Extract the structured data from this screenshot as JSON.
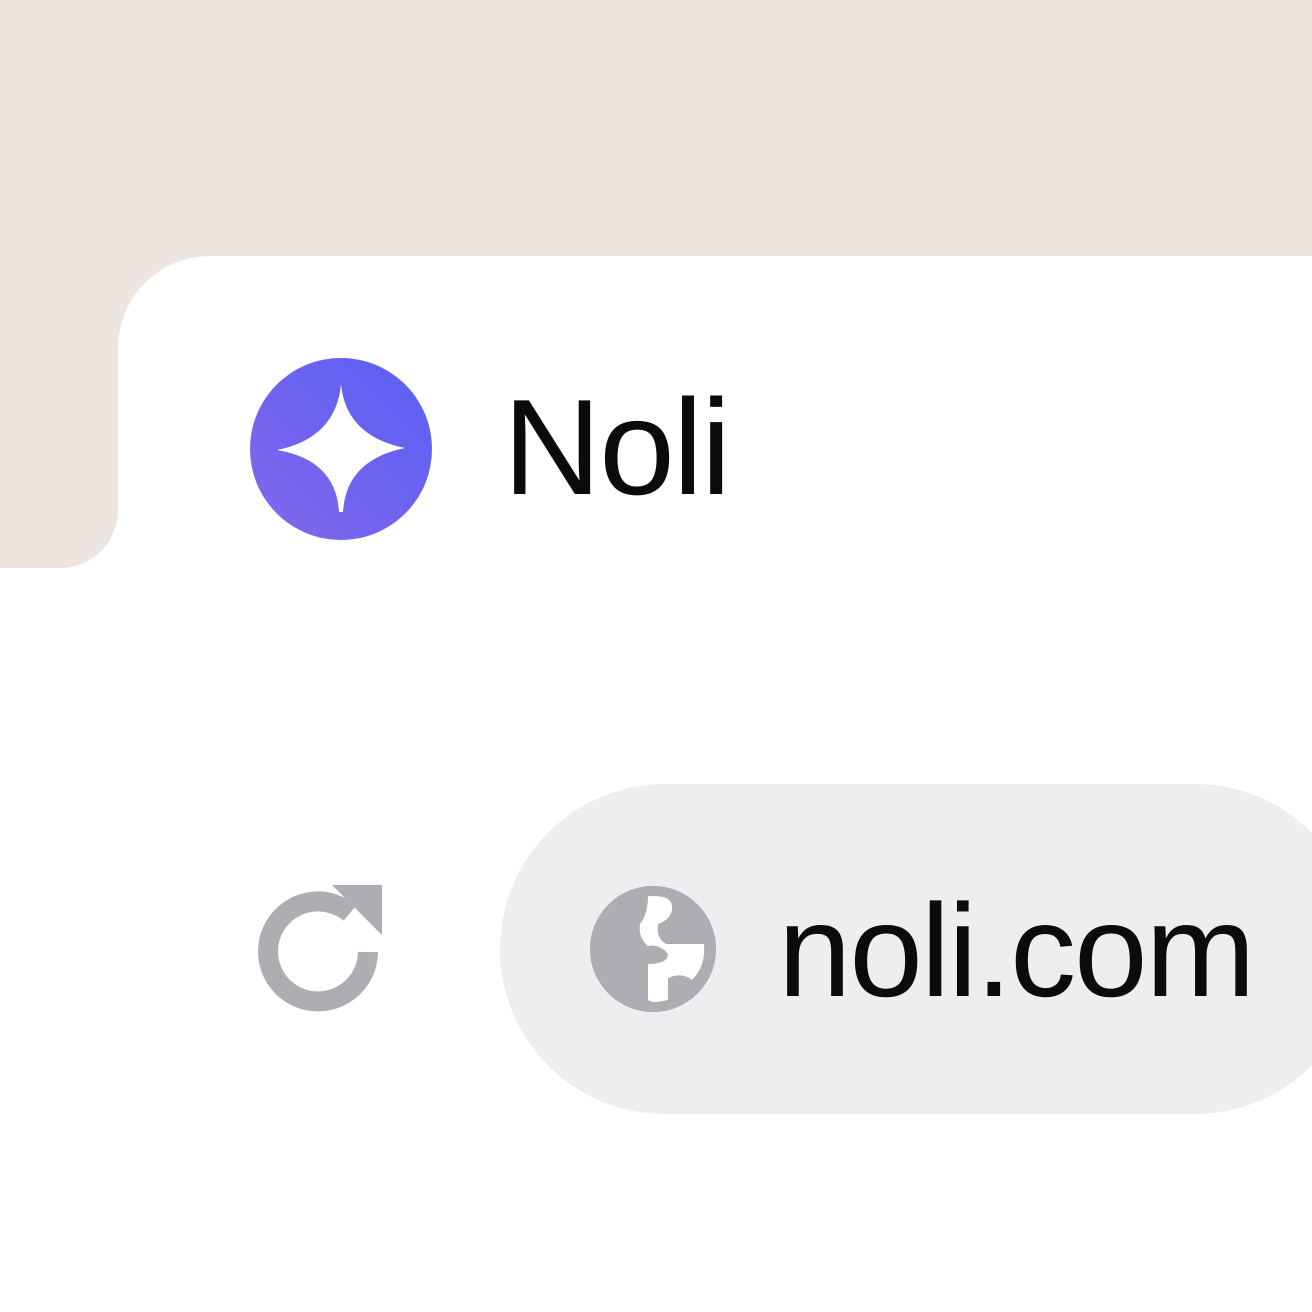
{
  "tab": {
    "title": "Noli",
    "favicon": "sparkle-icon",
    "favicon_color": "#6366f1"
  },
  "toolbar": {
    "reload_icon": "reload-icon",
    "address_bar": {
      "site_icon": "globe-icon",
      "url": "noli.com"
    }
  },
  "colors": {
    "tab_strip": "#ede5df",
    "address_bar": "#efedf0",
    "icon_gray": "#a9a8ac"
  }
}
